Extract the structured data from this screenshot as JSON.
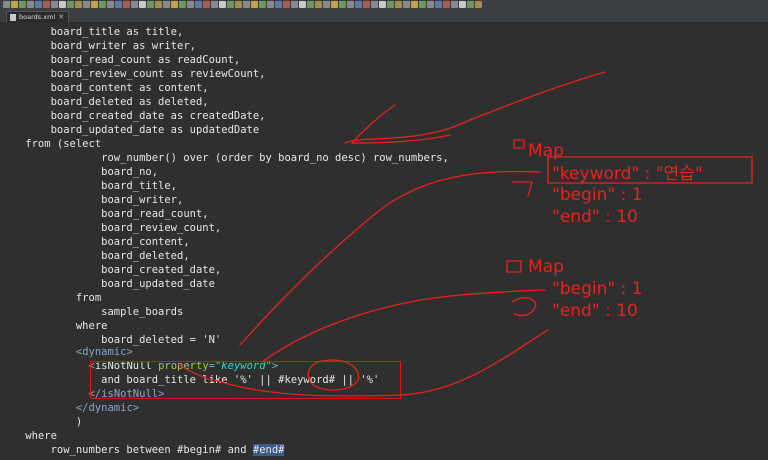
{
  "tab": {
    "file_name": "boards.xml"
  },
  "code_lines": [
    "        board_title as title,",
    "        board_writer as writer,",
    "        board_read_count as readCount,",
    "        board_review_count as reviewCount,",
    "        board_content as content,",
    "        board_deleted as deleted,",
    "        board_created_date as createdDate,",
    "        board_updated_date as updatedDate",
    "    from (select",
    "                row_number() over (order by board_no desc) row_numbers,",
    "                board_no,",
    "                board_title,",
    "                board_writer,",
    "                board_read_count,",
    "                board_review_count,",
    "                board_content,",
    "                board_deleted,",
    "                board_created_date,",
    "                board_updated_date",
    "            from",
    "                sample_boards",
    "            where",
    "                board_deleted = 'N'"
  ],
  "dynamic_block": {
    "indent_open": "            ",
    "dynamic_open": "dynamic",
    "indent_is": "              ",
    "isnotnull_name": "isNotNull",
    "property_attr": "property",
    "property_value": "\"keyword\"",
    "like_line": "                and board_title like '%' || #keyword# || '%'",
    "isnotnull_close": "isNotNull",
    "dynamic_close": "dynamic"
  },
  "tail_lines": [
    "            )",
    "    where",
    "        row_numbers between #begin# and "
  ],
  "tail_highlight": "#end#",
  "annotations": {
    "map1_label": "Map",
    "map1_keyword": "\"keyword\" : \"연습\"",
    "map1_begin": "\"begin\" : 1",
    "map1_end": "\"end\" : 10",
    "map2_label": "Map",
    "map2_begin": "\"begin\" : 1",
    "map2_end": "\"end\" : 10"
  },
  "colors": {
    "editor_bg": "#2f2f2f",
    "ink": "#e8221c",
    "xml_tag": "#8aa4c8",
    "xml_attr": "#a6c850",
    "xml_attr_value": "#40d6c8",
    "selection": "#3a5a8c"
  }
}
